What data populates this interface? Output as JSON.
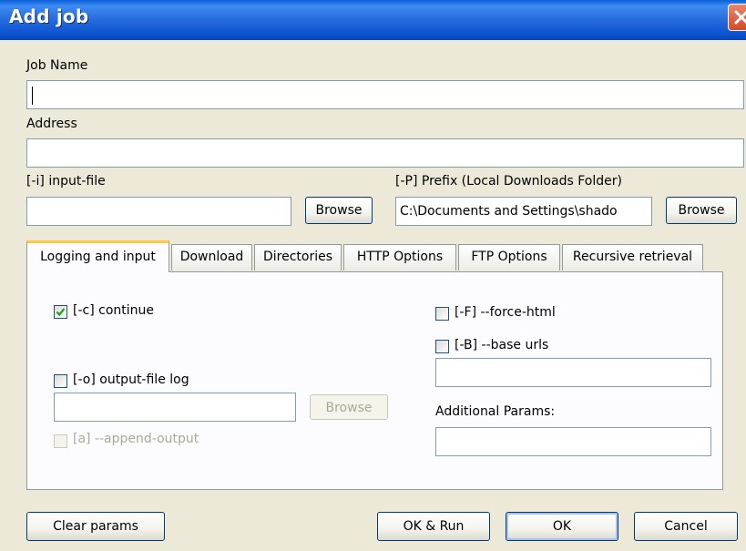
{
  "window": {
    "title": "Add job"
  },
  "job_name": {
    "label": "Job Name",
    "value": ""
  },
  "address": {
    "label": "Address",
    "value": ""
  },
  "input_file": {
    "label": "[-i] input-file",
    "value": "",
    "browse_label": "Browse"
  },
  "prefix": {
    "label": "[-P] Prefix (Local Downloads Folder)",
    "value": "C:\\Documents and Settings\\shado",
    "browse_label": "Browse"
  },
  "tabs": [
    {
      "label": "Logging and input",
      "active": true
    },
    {
      "label": "Download",
      "active": false
    },
    {
      "label": "Directories",
      "active": false
    },
    {
      "label": "HTTP Options",
      "active": false
    },
    {
      "label": "FTP Options",
      "active": false
    },
    {
      "label": "Recursive retrieval",
      "active": false
    }
  ],
  "logging": {
    "continue": {
      "label": "[-c] continue",
      "checked": true
    },
    "output_file_log": {
      "label": "[-o] output-file log",
      "checked": false,
      "value": "",
      "browse_label": "Browse",
      "browse_enabled": false
    },
    "append_output": {
      "label": "[a] --append-output",
      "checked": false,
      "enabled": false
    },
    "force_html": {
      "label": "[-F] --force-html",
      "checked": false
    },
    "base_urls": {
      "label": "[-B] --base urls",
      "checked": false,
      "value": ""
    },
    "additional_params": {
      "label": "Additional Params:",
      "value": ""
    }
  },
  "footer": {
    "clear_label": "Clear params",
    "ok_run_label": "OK & Run",
    "ok_label": "OK",
    "cancel_label": "Cancel"
  },
  "colors": {
    "titlebar": "#2a6fe0",
    "dialog_bg": "#ece9d8",
    "tab_highlight": "#ffc83c",
    "checkmark": "#21a121"
  }
}
